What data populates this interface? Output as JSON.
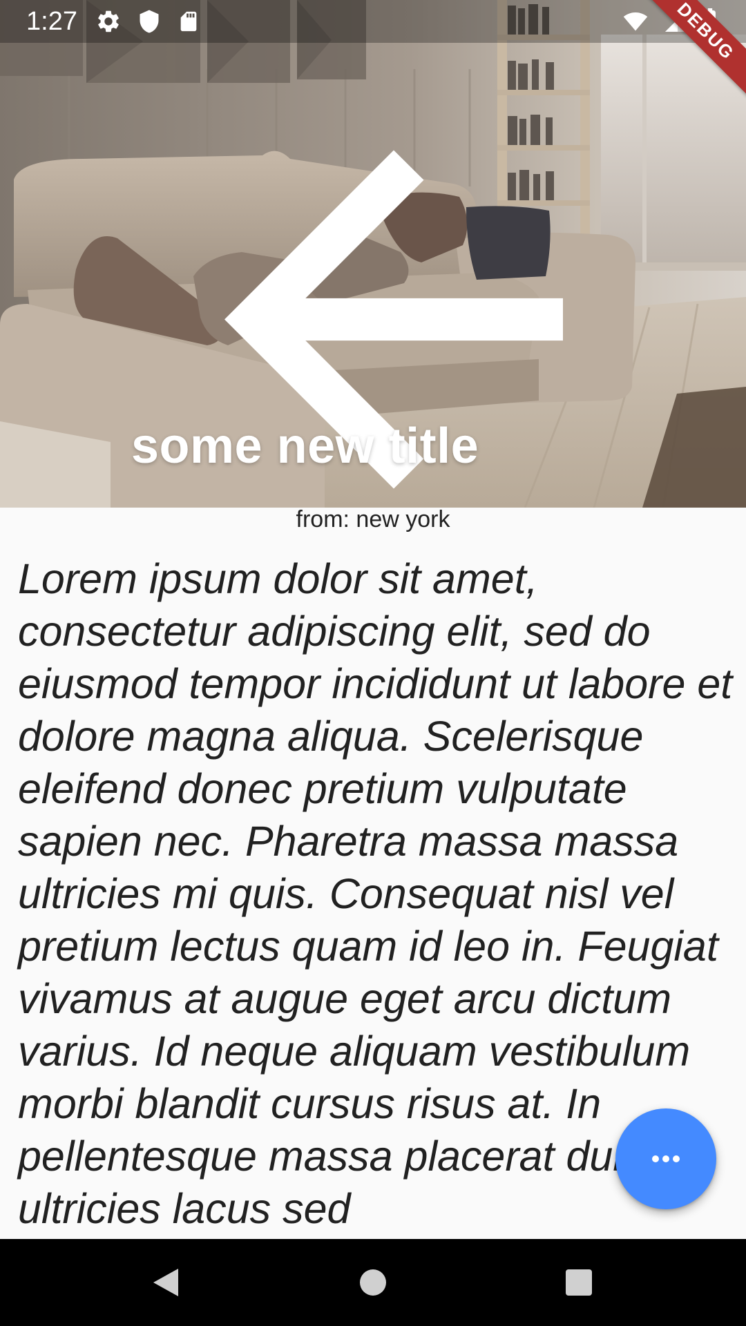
{
  "status_bar": {
    "time": "1:27",
    "left_icons": [
      "settings-icon",
      "shield-icon",
      "sd-card-icon"
    ],
    "right_icons": [
      "wifi-icon",
      "cell-signal-icon",
      "battery-icon"
    ]
  },
  "debug_banner": {
    "label": "DEBUG",
    "color": "#b0312f"
  },
  "app_bar": {
    "back_icon": "arrow-back-icon",
    "title": "some new title"
  },
  "content": {
    "subtitle": "from: new york",
    "body": "Lorem ipsum dolor sit amet, consectetur adipiscing elit, sed do eiusmod tempor incididunt ut labore et dolore magna aliqua. Scelerisque eleifend donec pretium vulputate sapien nec. Pharetra massa massa ultricies mi quis. Consequat nisl vel pretium lectus quam id leo in. Feugiat vivamus at augue eget arcu dictum varius. Id neque aliquam vestibulum morbi blandit cursus risus at. In pellentesque massa placerat duis ultricies lacus sed"
  },
  "fab": {
    "icon": "more-horiz-icon",
    "color": "#448aff"
  },
  "nav_bar": {
    "buttons": [
      "back-triangle-icon",
      "home-circle-icon",
      "recents-square-icon"
    ]
  }
}
